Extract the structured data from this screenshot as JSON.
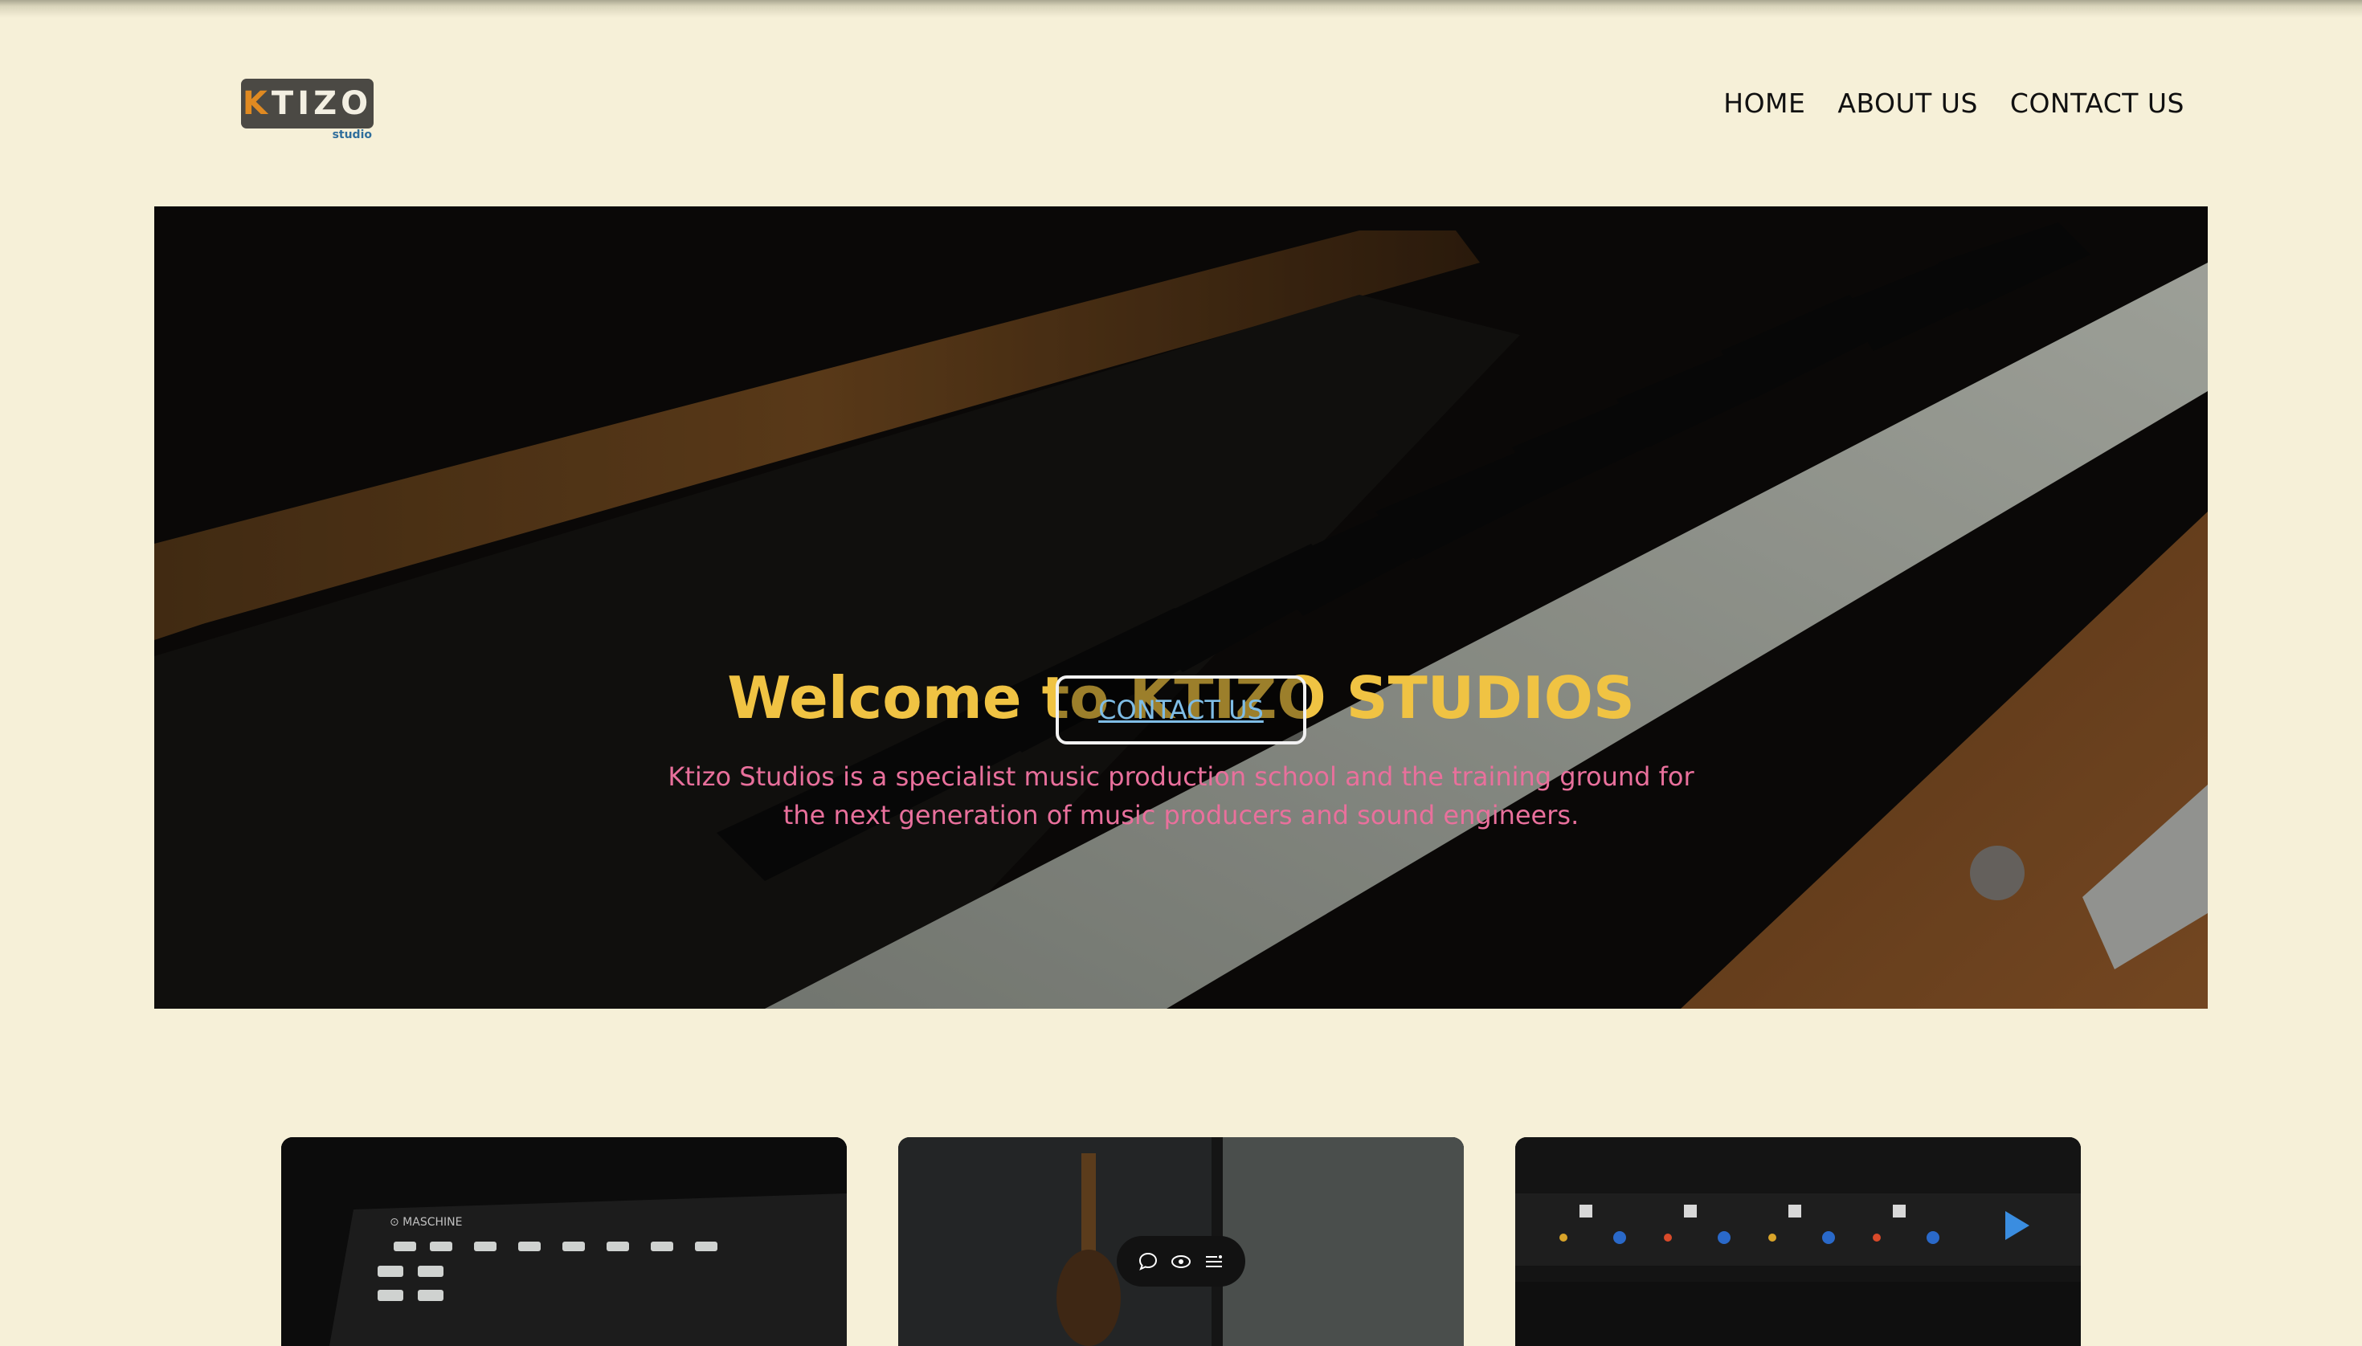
{
  "brand": {
    "logo_text": "KTIZO",
    "logo_sub": "studio"
  },
  "nav": {
    "items": [
      {
        "label": "HOME"
      },
      {
        "label": "ABOUT US"
      },
      {
        "label": "CONTACT US"
      }
    ]
  },
  "hero": {
    "title": "Welcome to KTIZO STUDIOS",
    "subtitle": "Ktizo Studios is a specialist music production school and the training ground for the next generation of music producers and sound engineers.",
    "button_label": "CONTACT US"
  },
  "cards": [
    {
      "icon": "drum-machine-photo"
    },
    {
      "icon": "guitar-amp-photo"
    },
    {
      "icon": "rack-equipment-photo"
    }
  ],
  "colors": {
    "page_bg": "#f6f0d8",
    "title": "#f0c343",
    "subtitle": "#e9709c",
    "button_text": "#7fbde6"
  },
  "toolbar": {
    "icons": [
      "comment-icon",
      "eye-icon",
      "list-icon"
    ]
  }
}
